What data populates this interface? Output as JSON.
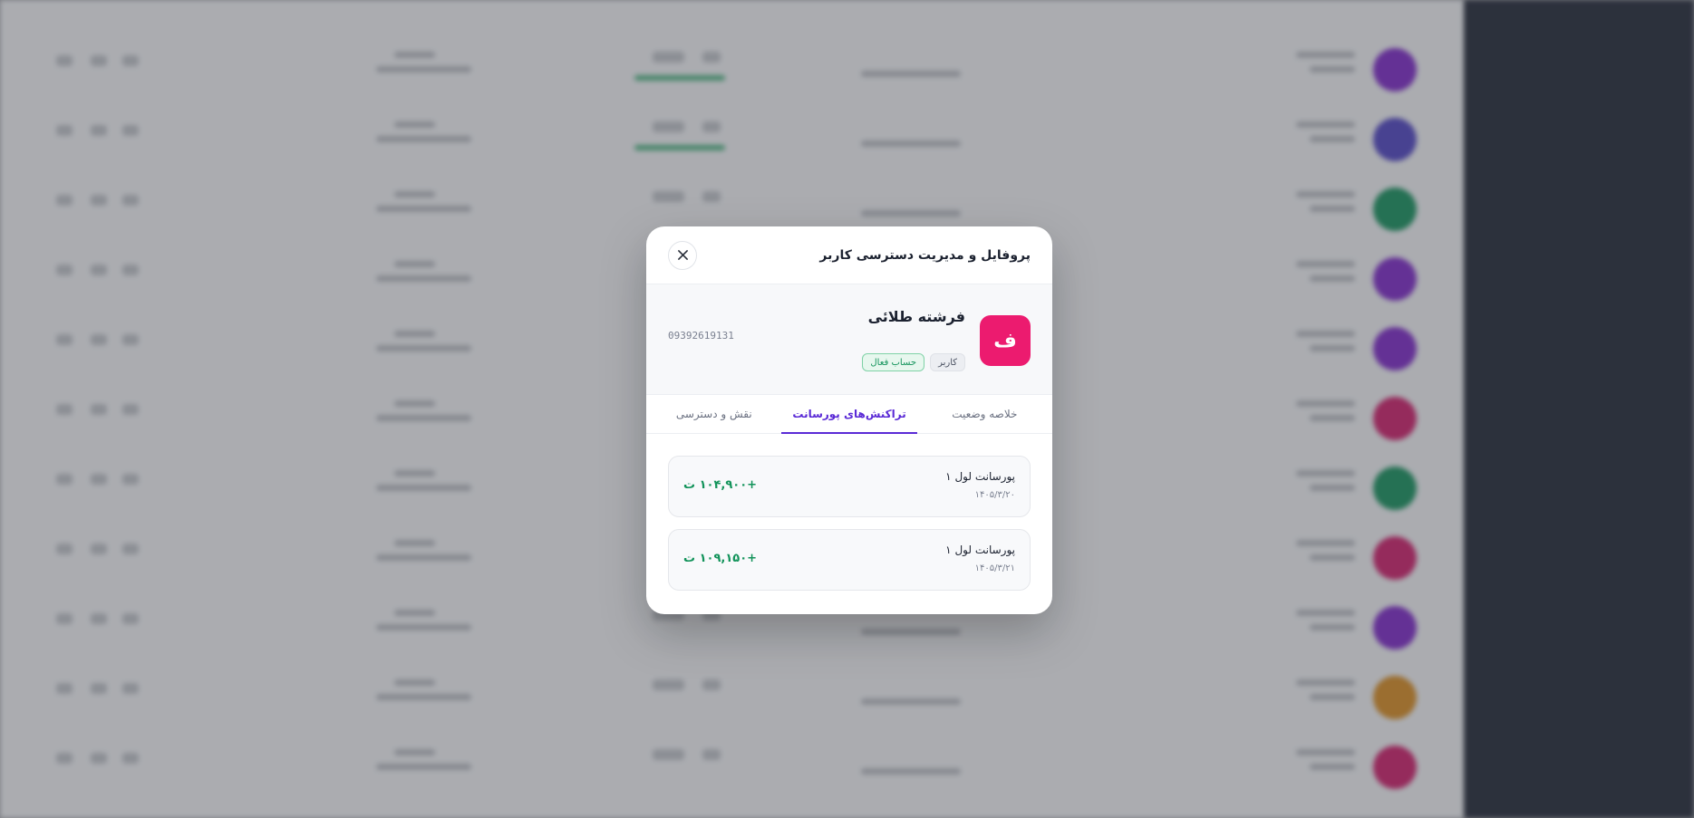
{
  "modal": {
    "title": "پروفایل و مدیریت دسترسی کاربر",
    "close_label": "close"
  },
  "profile": {
    "avatar_letter": "ف",
    "name": "فرشته طلائی",
    "phone": "09392619131",
    "role_badge": "کاربر",
    "status_badge": "حساب فعال"
  },
  "tabs": [
    {
      "label": "خلاصه وضعیت",
      "active": false
    },
    {
      "label": "تراکنش‌های پورسانت",
      "active": true
    },
    {
      "label": "نقش و دسترسی",
      "active": false
    }
  ],
  "transactions": [
    {
      "title": "پورسانت لول ۱",
      "date": "۱۴۰۵/۳/۲۰",
      "amount": "+۱۰۴,۹۰۰ ت"
    },
    {
      "title": "پورسانت لول ۱",
      "date": "۱۴۰۵/۳/۲۱",
      "amount": "+۱۰۹,۱۵۰ ت"
    }
  ],
  "colors": {
    "accent": "#5a2ad6",
    "avatar": "#ec1b6f",
    "positive": "#12935a"
  },
  "background_rows": [
    {
      "avatar_color": "#7b22c8"
    },
    {
      "avatar_color": "#4b3fc2"
    },
    {
      "avatar_color": "#0f8f58"
    },
    {
      "avatar_color": "#7b22c8"
    },
    {
      "avatar_color": "#7b22c8"
    },
    {
      "avatar_color": "#cf1766"
    },
    {
      "avatar_color": "#0f8f58"
    },
    {
      "avatar_color": "#cf1766"
    },
    {
      "avatar_color": "#7b22c8"
    },
    {
      "avatar_color": "#d98a1a"
    },
    {
      "avatar_color": "#cf1766"
    }
  ]
}
